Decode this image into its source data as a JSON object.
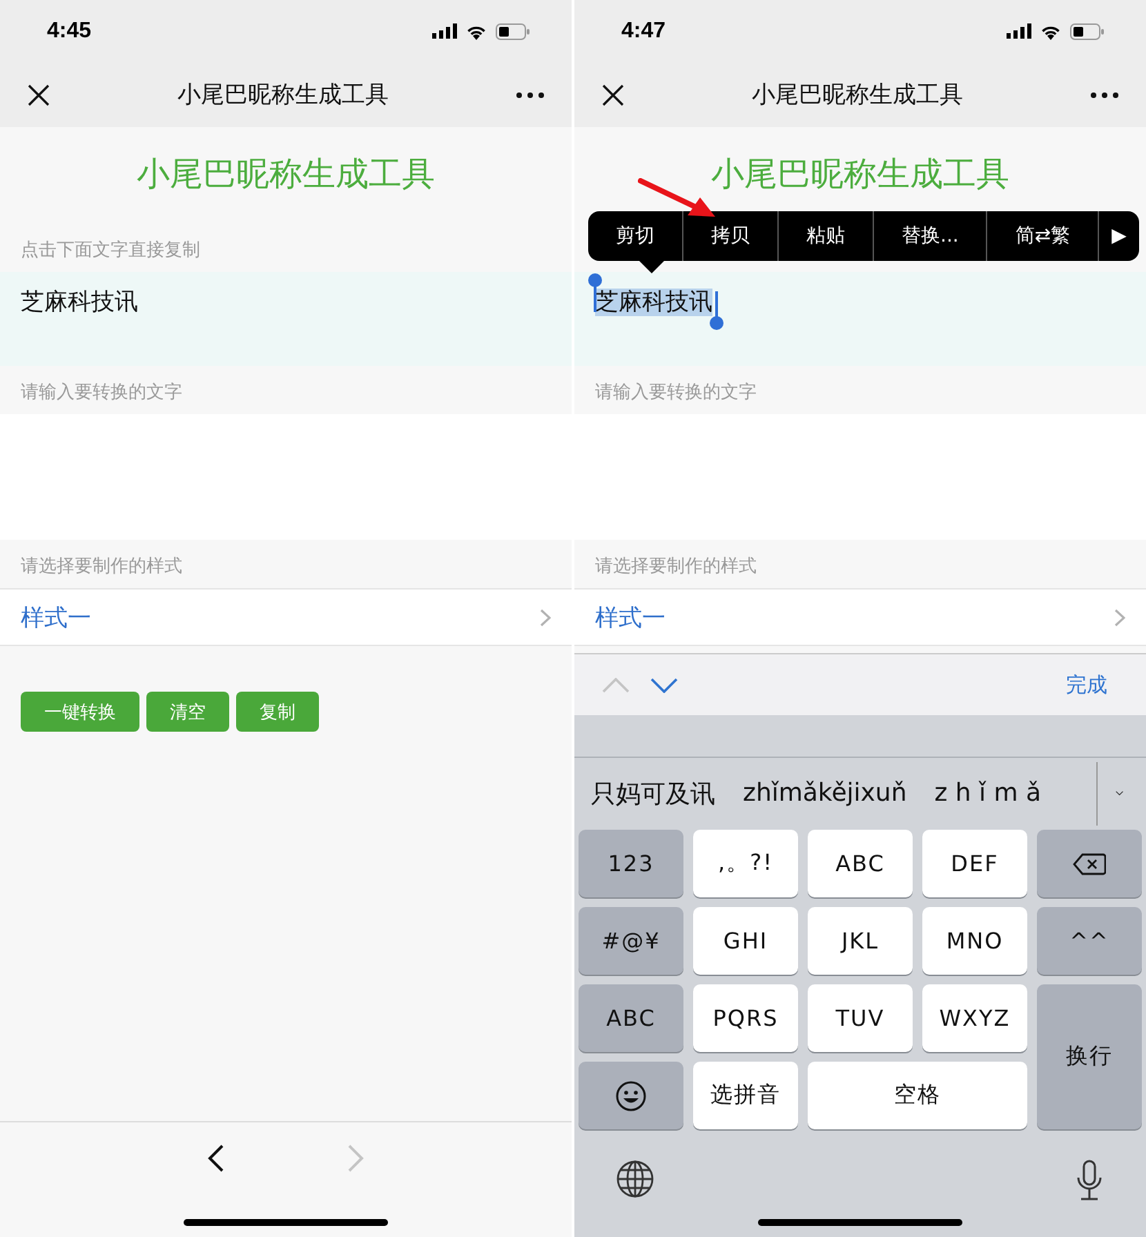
{
  "screens": [
    {
      "status_bar": {
        "time": "4:45"
      },
      "nav_bar": {
        "title": "小尾巴昵称生成工具"
      },
      "heading": "小尾巴昵称生成工具",
      "copy_hint": "点击下面文字直接复制",
      "result_text": "芝麻科技讯",
      "result_selected": false,
      "input_label": "请输入要转换的文字",
      "style_label": "请选择要制作的样式",
      "style_value": "样式一",
      "buttons": [
        "一键转换",
        "清空",
        "复制"
      ],
      "browser_toolbar": {
        "back_disabled": false,
        "forward_disabled": true
      }
    },
    {
      "status_bar": {
        "time": "4:47"
      },
      "nav_bar": {
        "title": "小尾巴昵称生成工具"
      },
      "heading": "小尾巴昵称生成工具",
      "result_text": "芝麻科技讯",
      "result_selected": true,
      "edit_menu": [
        {
          "label": "剪切",
          "pointed": false
        },
        {
          "label": "拷贝",
          "pointed": true
        },
        {
          "label": "粘贴",
          "pointed": false
        },
        {
          "label": "替换...",
          "pointed": false
        },
        {
          "label": "简⇄繁",
          "pointed": false
        },
        {
          "label": "▶",
          "pointed": false
        }
      ],
      "input_label": "请输入要转换的文字",
      "style_label": "请选择要制作的样式",
      "style_value": "样式一",
      "keyboard": {
        "toolbar": {
          "up_disabled": true,
          "down_disabled": false,
          "done": "完成"
        },
        "candidates": [
          "只妈可及讯",
          "zhǐmǎkějixuň",
          "z h ǐ m ǎ"
        ],
        "keys": [
          {
            "kind": "function",
            "label": "123"
          },
          {
            "kind": "letter",
            "label": ",。?!"
          },
          {
            "kind": "letter",
            "label": "ABC"
          },
          {
            "kind": "letter",
            "label": "DEF"
          },
          {
            "kind": "delete"
          },
          {
            "kind": "function",
            "label": "#@¥"
          },
          {
            "kind": "letter",
            "label": "GHI"
          },
          {
            "kind": "letter",
            "label": "JKL"
          },
          {
            "kind": "letter",
            "label": "MNO"
          },
          {
            "kind": "function",
            "label": "^^"
          },
          {
            "kind": "function",
            "label": "ABC"
          },
          {
            "kind": "letter",
            "label": "PQRS"
          },
          {
            "kind": "letter",
            "label": "TUV"
          },
          {
            "kind": "letter",
            "label": "WXYZ"
          },
          {
            "kind": "return",
            "label": "换行"
          },
          {
            "kind": "emoji"
          },
          {
            "kind": "letter",
            "label": "选拼音"
          },
          {
            "kind": "space",
            "label": "空格"
          }
        ]
      }
    }
  ]
}
